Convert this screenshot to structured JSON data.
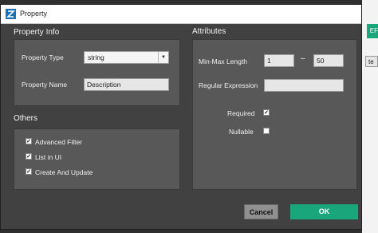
{
  "window": {
    "title": "Property"
  },
  "backdrop": {
    "partial_button": "EF",
    "partial_chip": "te"
  },
  "property_info": {
    "header": "Property Info",
    "type_label": "Property Type",
    "type_value": "string",
    "name_label": "Property Name",
    "name_value": "Description"
  },
  "others": {
    "header": "Others",
    "items": [
      {
        "label": "Advanced Filter",
        "checked": true
      },
      {
        "label": "List in UI",
        "checked": true
      },
      {
        "label": "Create And Update",
        "checked": true
      }
    ]
  },
  "attributes": {
    "header": "Attributes",
    "minmax_label": "Min-Max Length",
    "min_value": "1",
    "separator": "–",
    "max_value": "50",
    "regex_label": "Regular Expression",
    "regex_value": "",
    "required_label": "Required",
    "required_checked": true,
    "nullable_label": "Nullable",
    "nullable_checked": false
  },
  "buttons": {
    "cancel": "Cancel",
    "ok": "OK"
  },
  "colors": {
    "accent": "#19a67a",
    "panel": "#585858",
    "dialog": "#414141"
  }
}
